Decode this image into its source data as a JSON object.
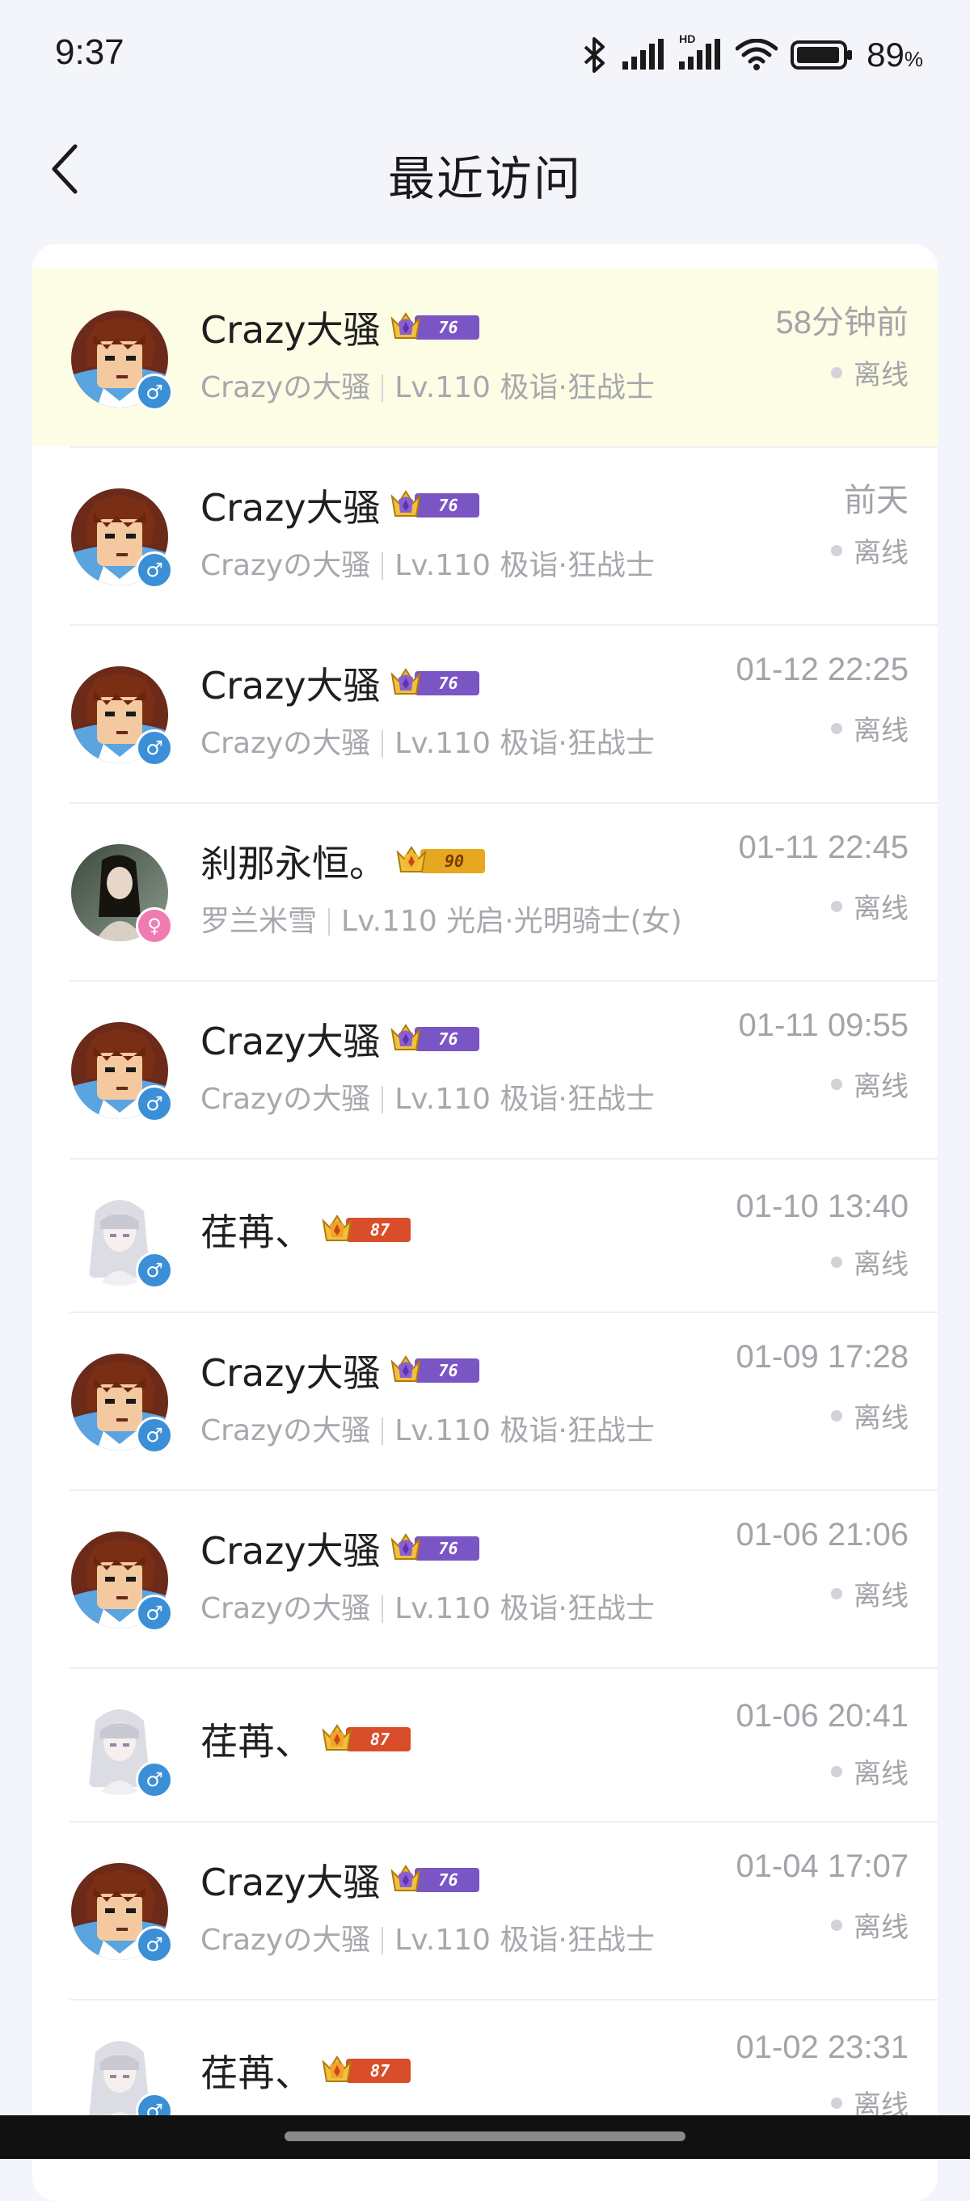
{
  "status_bar": {
    "time": "9:37",
    "battery_percent": "89",
    "battery_unit": "%",
    "hd_label": "HD",
    "icons": [
      "bluetooth-icon",
      "signal-icon",
      "hd-signal-icon",
      "wifi-icon",
      "battery-icon"
    ]
  },
  "header": {
    "title": "最近访问",
    "back_icon": "chevron-left-icon"
  },
  "colors": {
    "highlight_row": "#fdfde6",
    "male": "#3b8fd6",
    "female": "#f07bb1",
    "badge_purple": "#7a55c4",
    "badge_gold": "#e7a821",
    "badge_red": "#d94d2a"
  },
  "visitors": [
    {
      "name": "Crazy大骚",
      "level": "76",
      "badge": "purple",
      "sub_name": "Crazyの大骚",
      "sub_info": "Lv.110 极诣·狂战士",
      "time": "58分钟前",
      "status": "离线",
      "gender": "male",
      "avatar": "pixel-man-avatar"
    },
    {
      "name": "Crazy大骚",
      "level": "76",
      "badge": "purple",
      "sub_name": "Crazyの大骚",
      "sub_info": "Lv.110 极诣·狂战士",
      "time": "前天",
      "status": "离线",
      "gender": "male",
      "avatar": "pixel-man-avatar"
    },
    {
      "name": "Crazy大骚",
      "level": "76",
      "badge": "purple",
      "sub_name": "Crazyの大骚",
      "sub_info": "Lv.110 极诣·狂战士",
      "time": "01-12 22:25",
      "status": "离线",
      "gender": "male",
      "avatar": "pixel-man-avatar"
    },
    {
      "name": "刹那永恒。",
      "level": "90",
      "badge": "gold",
      "sub_name": "罗兰米雪",
      "sub_info": "Lv.110 光启·光明骑士(女)",
      "time": "01-11 22:45",
      "status": "离线",
      "gender": "female",
      "avatar": "photo-avatar"
    },
    {
      "name": "Crazy大骚",
      "level": "76",
      "badge": "purple",
      "sub_name": "Crazyの大骚",
      "sub_info": "Lv.110 极诣·狂战士",
      "time": "01-11 09:55",
      "status": "离线",
      "gender": "male",
      "avatar": "pixel-man-avatar"
    },
    {
      "name": "荏苒、",
      "level": "87",
      "badge": "red",
      "sub_name": "",
      "sub_info": "",
      "time": "01-10 13:40",
      "status": "离线",
      "gender": "male",
      "avatar": "anime-girl-avatar"
    },
    {
      "name": "Crazy大骚",
      "level": "76",
      "badge": "purple",
      "sub_name": "Crazyの大骚",
      "sub_info": "Lv.110 极诣·狂战士",
      "time": "01-09 17:28",
      "status": "离线",
      "gender": "male",
      "avatar": "pixel-man-avatar"
    },
    {
      "name": "Crazy大骚",
      "level": "76",
      "badge": "purple",
      "sub_name": "Crazyの大骚",
      "sub_info": "Lv.110 极诣·狂战士",
      "time": "01-06 21:06",
      "status": "离线",
      "gender": "male",
      "avatar": "pixel-man-avatar"
    },
    {
      "name": "荏苒、",
      "level": "87",
      "badge": "red",
      "sub_name": "",
      "sub_info": "",
      "time": "01-06 20:41",
      "status": "离线",
      "gender": "male",
      "avatar": "anime-girl-avatar"
    },
    {
      "name": "Crazy大骚",
      "level": "76",
      "badge": "purple",
      "sub_name": "Crazyの大骚",
      "sub_info": "Lv.110 极诣·狂战士",
      "time": "01-04 17:07",
      "status": "离线",
      "gender": "male",
      "avatar": "pixel-man-avatar"
    },
    {
      "name": "荏苒、",
      "level": "87",
      "badge": "red",
      "sub_name": "",
      "sub_info": "",
      "time": "01-02 23:31",
      "status": "离线",
      "gender": "male",
      "avatar": "anime-girl-avatar"
    }
  ]
}
